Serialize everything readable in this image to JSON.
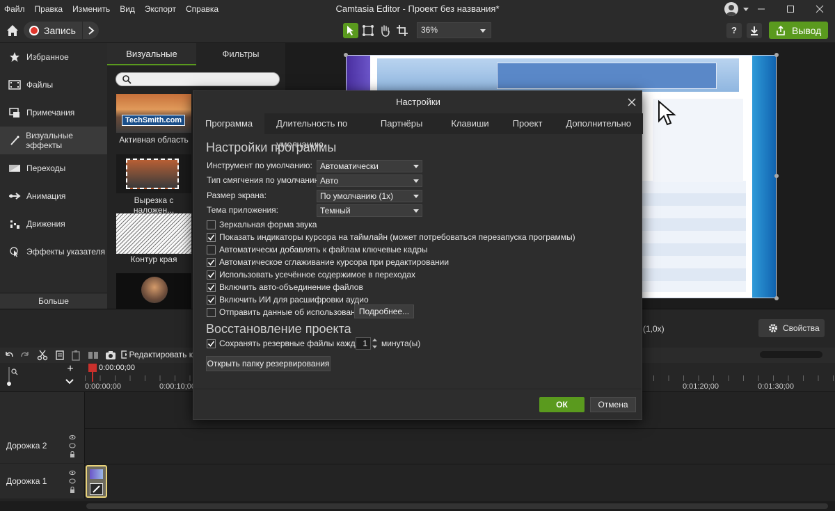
{
  "app": {
    "title": "Camtasia Editor - Проект без названия*",
    "menus": [
      "Файл",
      "Правка",
      "Изменить",
      "Вид",
      "Экспорт",
      "Справка"
    ]
  },
  "toolbar": {
    "record_label": "Запись",
    "zoom_value": "36%",
    "export_label": "Вывод",
    "accent_color": "#5a9a1e"
  },
  "leftnav": {
    "items": [
      {
        "label": "Избранное",
        "icon": "star-icon"
      },
      {
        "label": "Файлы",
        "icon": "film-icon"
      },
      {
        "label": "Примечания",
        "icon": "annotation-icon"
      },
      {
        "label": "Визуальные эффекты",
        "icon": "magic-wand-icon"
      },
      {
        "label": "Переходы",
        "icon": "transition-icon"
      },
      {
        "label": "Анимация",
        "icon": "animation-arrow-icon"
      },
      {
        "label": "Движения",
        "icon": "behaviors-icon"
      },
      {
        "label": "Эффекты указателя",
        "icon": "cursor-effect-icon"
      }
    ],
    "more_label": "Больше"
  },
  "effects": {
    "tab_visual": "Визуальные эффекты",
    "tab_filters": "Фильтры",
    "thumbs": [
      {
        "label": "Активная область",
        "overlay": "TechSmith.com"
      },
      {
        "label": "Вырезка с наложен..."
      },
      {
        "label": "Контур края"
      }
    ]
  },
  "timeline": {
    "edit_label": "Редактировать к",
    "playhead_time": "0:00:00;00",
    "ruler": [
      "0:00:00;00",
      "0:00:10;00",
      "0:01:20;00",
      "0:01:30;00"
    ],
    "speed": "(1,0x)",
    "properties_label": "Свойства",
    "tracks": [
      "Дорожка 2",
      "Дорожка 1"
    ]
  },
  "dialog": {
    "title": "Настройки",
    "tabs": [
      "Программа",
      "Длительность по умолчанию",
      "Партнёры",
      "Клавиши",
      "Проект",
      "Дополнительно"
    ],
    "heading_program": "Настройки программы",
    "fields": [
      {
        "label": "Инструмент по умолчанию:",
        "value": "Автоматически"
      },
      {
        "label": "Тип смягчения по умолчанию:",
        "value": "Авто"
      },
      {
        "label": "Размер экрана:",
        "value": "По умолчанию (1x)"
      },
      {
        "label": "Тема приложения:",
        "value": "Темный"
      }
    ],
    "checkboxes": [
      {
        "label": "Зеркальная форма звука",
        "checked": false
      },
      {
        "label": "Показать индикаторы курсора на таймлайн (может потребоваться перезапуска программы)",
        "checked": true
      },
      {
        "label": "Автоматически добавлять к файлам ключевые кадры",
        "checked": false
      },
      {
        "label": "Автоматическое сглаживание курсора при редактировании",
        "checked": true
      },
      {
        "label": "Использовать усечённое содержимое в переходах",
        "checked": true
      },
      {
        "label": "Включить авто-объединение файлов",
        "checked": true
      },
      {
        "label": "Включить ИИ для расшифровки аудио",
        "checked": true
      },
      {
        "label": "Отправить данные об использовании",
        "checked": false
      }
    ],
    "more_button": "Подробнее...",
    "heading_recovery": "Восстановление проекта",
    "backup_label": "Сохранять резервные файлы каждые:",
    "backup_value": "1",
    "backup_unit": "минута(ы)",
    "open_folder_button": "Открыть папку резервирования",
    "ok_label": "ОК",
    "cancel_label": "Отмена"
  }
}
